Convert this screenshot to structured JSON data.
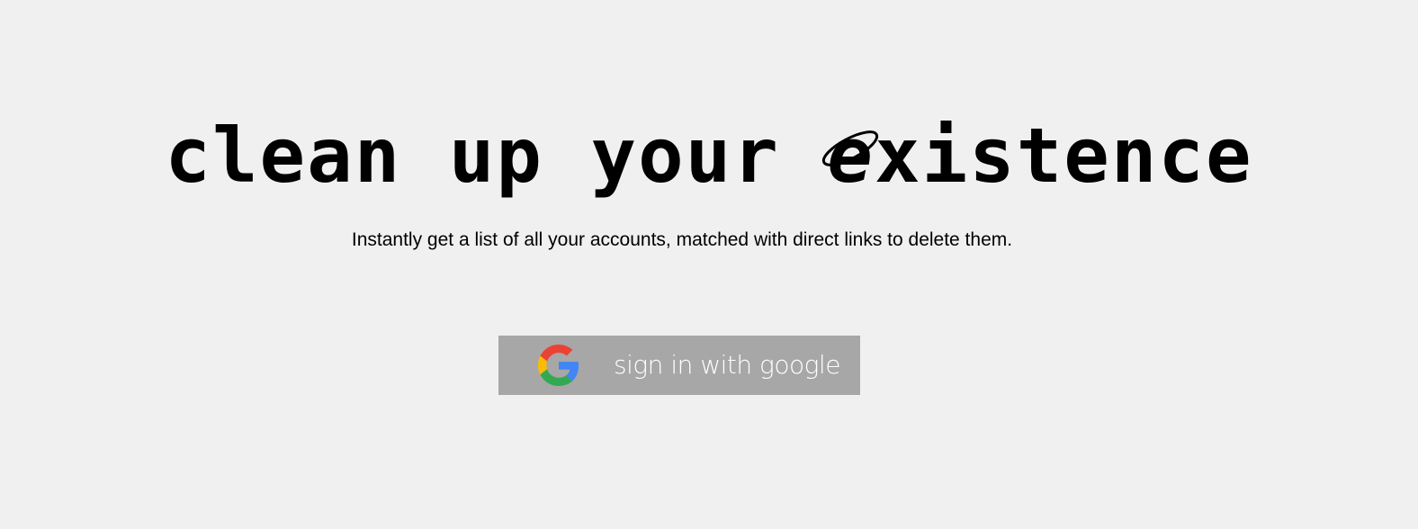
{
  "hero": {
    "title_before": "clean up your ",
    "title_e": "e",
    "title_after": "xistence",
    "subtitle": "Instantly get a list of all your accounts, matched with direct links to delete them."
  },
  "signin": {
    "label": "sign in with google",
    "icon": "google-g-icon",
    "background_color": "#a7a7a7",
    "text_color": "#ffffff"
  },
  "colors": {
    "page_background": "#f0f0f0",
    "text": "#000000",
    "google_blue": "#4285F4",
    "google_red": "#EA4335",
    "google_yellow": "#FBBC05",
    "google_green": "#34A853"
  }
}
